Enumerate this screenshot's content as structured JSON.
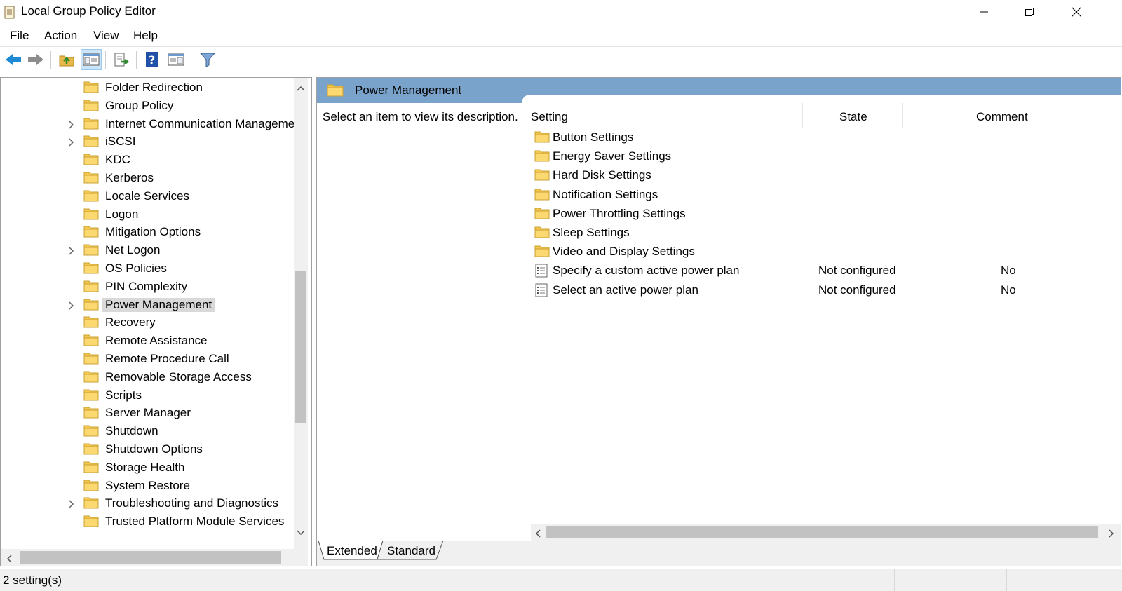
{
  "window": {
    "title": "Local Group Policy Editor"
  },
  "menu": [
    "File",
    "Action",
    "View",
    "Help"
  ],
  "toolbar": {
    "buttons": [
      "back-icon",
      "forward-icon",
      "up-folder-icon",
      "show-hide-tree-icon",
      "export-list-icon",
      "help-icon",
      "show-hide-action-pane-icon",
      "filter-icon"
    ]
  },
  "tree": {
    "items": [
      {
        "label": "Folder Redirection",
        "expandable": false
      },
      {
        "label": "Group Policy",
        "expandable": false
      },
      {
        "label": "Internet Communication Manageme",
        "expandable": true
      },
      {
        "label": "iSCSI",
        "expandable": true
      },
      {
        "label": "KDC",
        "expandable": false
      },
      {
        "label": "Kerberos",
        "expandable": false
      },
      {
        "label": "Locale Services",
        "expandable": false
      },
      {
        "label": "Logon",
        "expandable": false
      },
      {
        "label": "Mitigation Options",
        "expandable": false
      },
      {
        "label": "Net Logon",
        "expandable": true
      },
      {
        "label": "OS Policies",
        "expandable": false
      },
      {
        "label": "PIN Complexity",
        "expandable": false
      },
      {
        "label": "Power Management",
        "expandable": true,
        "selected": true
      },
      {
        "label": "Recovery",
        "expandable": false
      },
      {
        "label": "Remote Assistance",
        "expandable": false
      },
      {
        "label": "Remote Procedure Call",
        "expandable": false
      },
      {
        "label": "Removable Storage Access",
        "expandable": false
      },
      {
        "label": "Scripts",
        "expandable": false
      },
      {
        "label": "Server Manager",
        "expandable": false
      },
      {
        "label": "Shutdown",
        "expandable": false
      },
      {
        "label": "Shutdown Options",
        "expandable": false
      },
      {
        "label": "Storage Health",
        "expandable": false
      },
      {
        "label": "System Restore",
        "expandable": false
      },
      {
        "label": "Troubleshooting and Diagnostics",
        "expandable": true
      },
      {
        "label": "Trusted Platform Module Services",
        "expandable": false
      }
    ]
  },
  "details": {
    "header_title": "Power Management",
    "description": "Select an item to view its description.",
    "columns": {
      "setting": "Setting",
      "state": "State",
      "comment": "Comment"
    },
    "rows": [
      {
        "type": "folder",
        "name": "Button Settings",
        "state": "",
        "comment": ""
      },
      {
        "type": "folder",
        "name": "Energy Saver Settings",
        "state": "",
        "comment": ""
      },
      {
        "type": "folder",
        "name": "Hard Disk Settings",
        "state": "",
        "comment": ""
      },
      {
        "type": "folder",
        "name": "Notification Settings",
        "state": "",
        "comment": ""
      },
      {
        "type": "folder",
        "name": "Power Throttling Settings",
        "state": "",
        "comment": ""
      },
      {
        "type": "folder",
        "name": "Sleep Settings",
        "state": "",
        "comment": ""
      },
      {
        "type": "folder",
        "name": "Video and Display Settings",
        "state": "",
        "comment": ""
      },
      {
        "type": "setting",
        "name": "Specify a custom active power plan",
        "state": "Not configured",
        "comment": "No"
      },
      {
        "type": "setting",
        "name": "Select an active power plan",
        "state": "Not configured",
        "comment": "No"
      }
    ],
    "tabs": [
      "Extended",
      "Standard"
    ],
    "active_tab": "Extended"
  },
  "status": {
    "text": "2 setting(s)"
  },
  "colors": {
    "header_band": "#7aa3cc",
    "folder": "#f5c84c",
    "selection": "#d9d9d9"
  }
}
